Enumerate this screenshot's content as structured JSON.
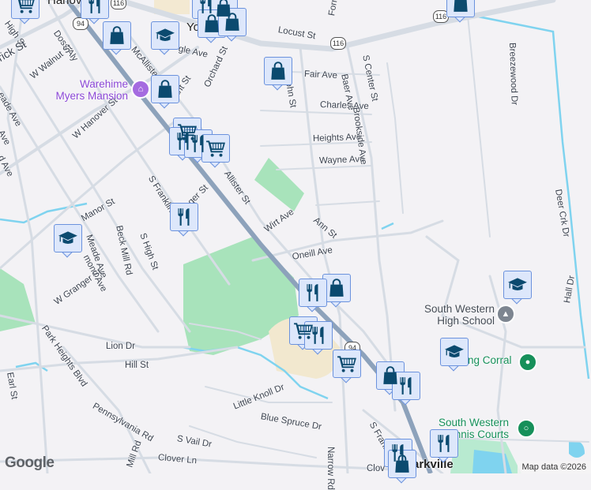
{
  "map": {
    "colors": {
      "background": "#f3f2f5",
      "road": "#d6dce4",
      "highway": "#8da2bb",
      "park": "#a8e3bb",
      "water": "#7fd3ef",
      "marker": "#0b4a6f"
    },
    "streets": [
      {
        "name": "High St"
      },
      {
        "name": "Doss Aly"
      },
      {
        "name": "rick St"
      },
      {
        "name": "W Walnut St"
      },
      {
        "name": "McAllister St"
      },
      {
        "name": "gle Ave"
      },
      {
        "name": "Locust St"
      },
      {
        "name": "Orchard St"
      },
      {
        "name": "ant St"
      },
      {
        "name": "eade Ave"
      },
      {
        "name": "W Hanover St"
      },
      {
        "name": "Fair Ave"
      },
      {
        "name": "Charles Ave"
      },
      {
        "name": "Heights Ave"
      },
      {
        "name": "Wayne Ave"
      },
      {
        "name": "Baer Ave"
      },
      {
        "name": "Brookside Ave"
      },
      {
        "name": "S Center St"
      },
      {
        "name": "Breezewood Dr"
      },
      {
        "name": "Deer Crk Dr"
      },
      {
        "name": "Allister St"
      },
      {
        "name": "S Franklin St"
      },
      {
        "name": "ger St"
      },
      {
        "name": "Manor St"
      },
      {
        "name": "Beck Mill Rd"
      },
      {
        "name": "S High St"
      },
      {
        "name": "Meade Ave"
      },
      {
        "name": "mond Ave"
      },
      {
        "name": "Wirt Ave"
      },
      {
        "name": "Ann St"
      },
      {
        "name": "Oneill Ave"
      },
      {
        "name": "W Granger St"
      },
      {
        "name": "Park Heights Blvd"
      },
      {
        "name": "Lion Dr"
      },
      {
        "name": "Hill St"
      },
      {
        "name": "Earl St"
      },
      {
        "name": "Little Knoll Dr"
      },
      {
        "name": "Blue Spruce Dr"
      },
      {
        "name": "Pennsylvania Rd"
      },
      {
        "name": "S Vail Dr"
      },
      {
        "name": "Narrow Rd"
      },
      {
        "name": "Clover Ln"
      },
      {
        "name": "Mill Rd"
      },
      {
        "name": "Hall Dr"
      },
      {
        "name": "S Frankl"
      },
      {
        "name": "Clov"
      },
      {
        "name": "John St"
      },
      {
        "name": "Forry"
      },
      {
        "name": "Ave"
      },
      {
        "name": "d Ave"
      }
    ],
    "places": {
      "hanover": "Hanov",
      "york": "Yo",
      "parkville": "Parkville",
      "mansion": "Warehime Myers Mansion",
      "high_school": "South Western High School",
      "corral": "ng Corral",
      "tennis": "South Western Tennis Courts"
    },
    "route_shields": [
      "94",
      "94",
      "116",
      "116",
      "116"
    ],
    "logo": "Google",
    "attribution": "Map data ©2026"
  }
}
